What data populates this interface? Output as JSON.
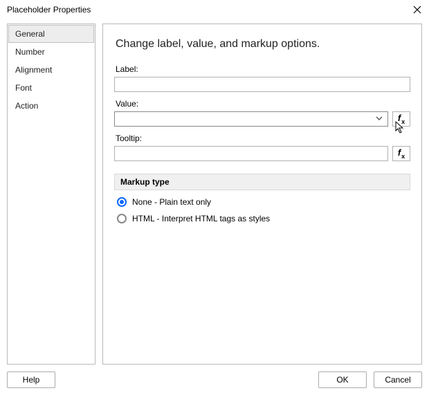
{
  "title": "Placeholder Properties",
  "sidebar": {
    "items": [
      {
        "label": "General",
        "active": true
      },
      {
        "label": "Number",
        "active": false
      },
      {
        "label": "Alignment",
        "active": false
      },
      {
        "label": "Font",
        "active": false
      },
      {
        "label": "Action",
        "active": false
      }
    ]
  },
  "main": {
    "heading": "Change label, value, and markup options.",
    "label_field": {
      "label": "Label:",
      "value": ""
    },
    "value_field": {
      "label": "Value:",
      "value": ""
    },
    "tooltip_field": {
      "label": "Tooltip:",
      "value": ""
    }
  },
  "markup": {
    "section_title": "Markup type",
    "options": [
      {
        "label": "None - Plain text only",
        "selected": true
      },
      {
        "label": "HTML - Interpret HTML tags as styles",
        "selected": false
      }
    ]
  },
  "buttons": {
    "help": "Help",
    "ok": "OK",
    "cancel": "Cancel"
  },
  "icons": {
    "fx": "fx"
  }
}
